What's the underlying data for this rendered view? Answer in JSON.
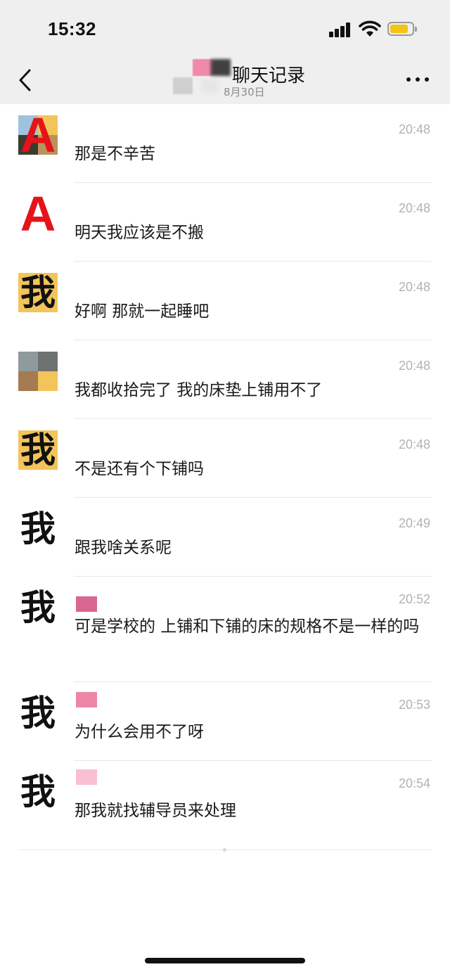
{
  "status_bar": {
    "time": "15:32"
  },
  "nav": {
    "title": "聊天记录",
    "subtitle": "8月30日",
    "back_icon": "chevron-left-icon",
    "more_icon": "ellipsis-icon"
  },
  "messages": [
    {
      "avatar": "A",
      "text": "那是不辛苦",
      "time": "20:48"
    },
    {
      "avatar": "A",
      "text": "明天我应该是不搬",
      "time": "20:48"
    },
    {
      "avatar": "我",
      "text": "好啊 那就一起睡吧",
      "time": "20:48"
    },
    {
      "avatar": "",
      "text": "我都收拾完了 我的床垫上铺用不了",
      "time": "20:48"
    },
    {
      "avatar": "我",
      "text": "不是还有个下铺吗",
      "time": "20:48"
    },
    {
      "avatar": "我",
      "text": "跟我啥关系呢",
      "time": "20:49"
    },
    {
      "avatar": "我",
      "text": "可是学校的 上铺和下铺的床的规格不是一样的吗",
      "time": "20:52"
    },
    {
      "avatar": "我",
      "text": "为什么会用不了呀",
      "time": "20:53"
    },
    {
      "avatar": "我",
      "text": "那我就找辅导员来处理",
      "time": "20:54"
    }
  ],
  "colors": {
    "background": "#ffffff",
    "header_bg": "#efefef",
    "timestamp": "#b2b2b2",
    "avatar_letter_red": "#e4141a",
    "battery_fill": "#f4c315"
  }
}
